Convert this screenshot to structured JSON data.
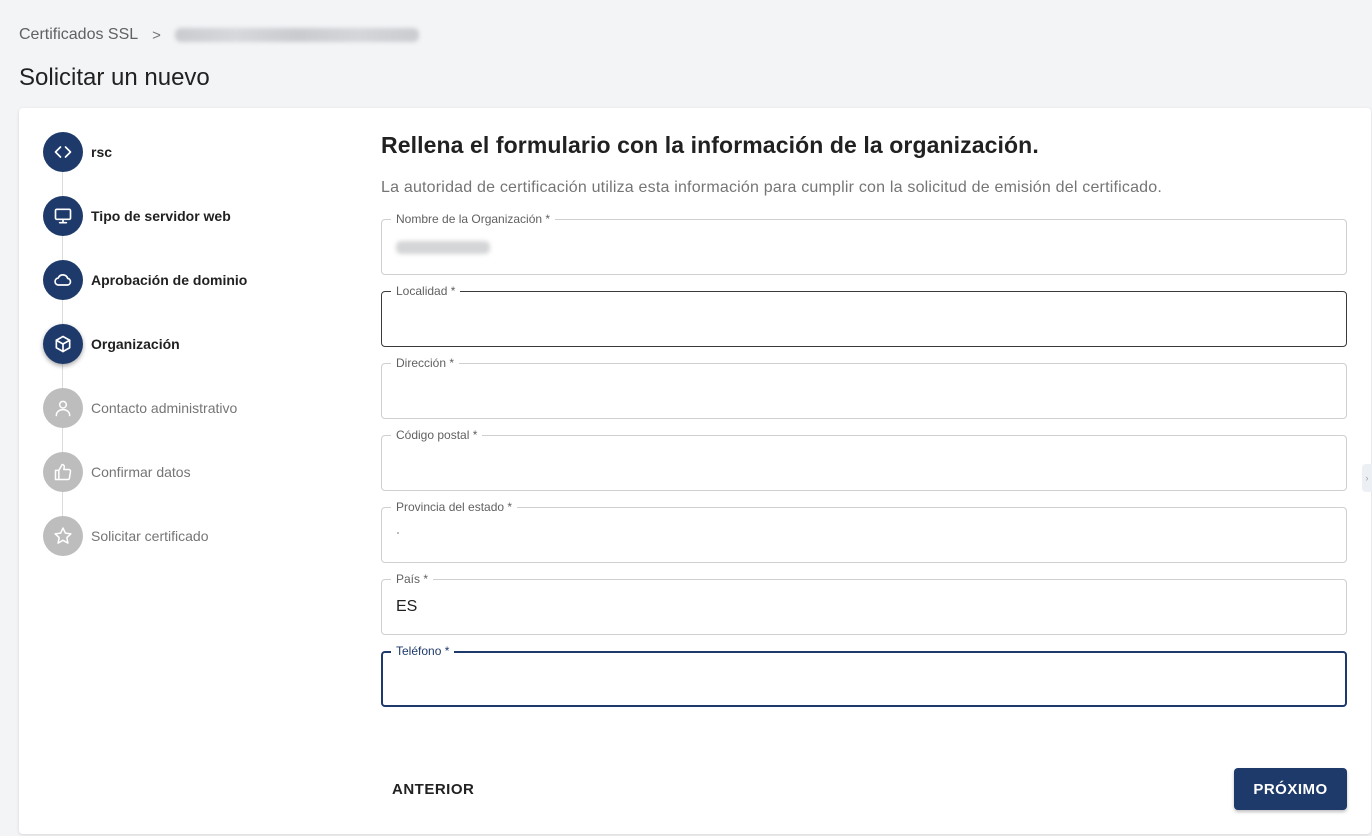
{
  "breadcrumb": {
    "root_label": "Certificados SSL",
    "separator": ">"
  },
  "page": {
    "title": "Solicitar un nuevo"
  },
  "stepper": {
    "steps": [
      {
        "label": "rsc",
        "icon": "code-icon",
        "state": "done"
      },
      {
        "label": "Tipo de servidor web",
        "icon": "monitor-icon",
        "state": "done"
      },
      {
        "label": "Aprobación de dominio",
        "icon": "cloud-icon",
        "state": "done"
      },
      {
        "label": "Organización",
        "icon": "cube-icon",
        "state": "current"
      },
      {
        "label": "Contacto administrativo",
        "icon": "user-icon",
        "state": "todo"
      },
      {
        "label": "Confirmar datos",
        "icon": "thumbs-up-icon",
        "state": "todo"
      },
      {
        "label": "Solicitar certificado",
        "icon": "star-icon",
        "state": "todo"
      }
    ]
  },
  "form": {
    "title": "Rellena el formulario con la información de la organización.",
    "description": "La autoridad de certificación utiliza esta información para cumplir con la solicitud de emisión del certificado.",
    "fields": {
      "org_name": {
        "label": "Nombre de la Organización *",
        "value": ""
      },
      "locality": {
        "label": "Localidad *",
        "value": ""
      },
      "address": {
        "label": "Dirección *",
        "value": ""
      },
      "postal_code": {
        "label": "Código postal *",
        "value": ""
      },
      "state": {
        "label": "Provincia del estado *",
        "value": ""
      },
      "country": {
        "label": "País *",
        "value": "ES"
      },
      "phone": {
        "label": "Teléfono *",
        "value": ""
      }
    }
  },
  "actions": {
    "prev_label": "ANTERIOR",
    "next_label": "PRÓXIMO"
  },
  "colors": {
    "primary": "#1e3a6a",
    "inactive_step": "#bdbdbd",
    "background": "#f3f4f6"
  }
}
